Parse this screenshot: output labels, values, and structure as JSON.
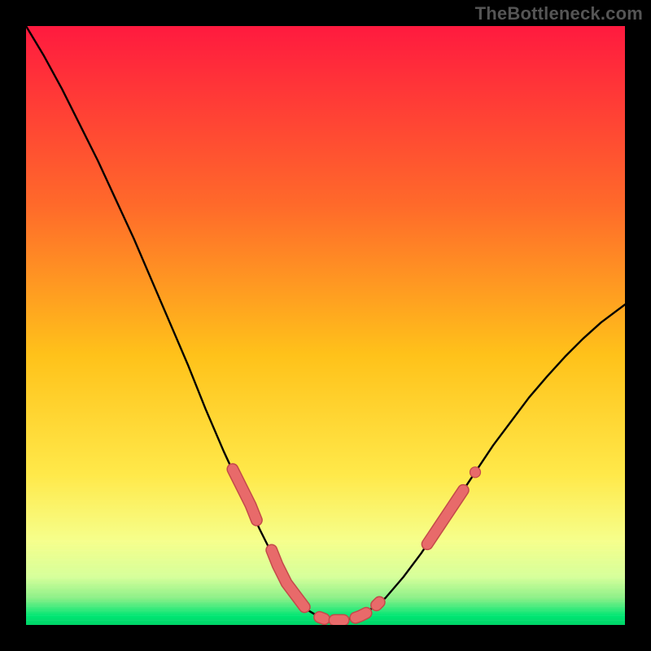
{
  "watermark": "TheBottleneck.com",
  "colors": {
    "page_bg": "#000000",
    "gradient_top": "#ff1a3f",
    "gradient_mid1": "#ff6a2a",
    "gradient_mid2": "#ffc21a",
    "gradient_mid3": "#ffe94a",
    "gradient_bottom_band": "#f6ff8c",
    "gradient_green": "#00e673",
    "curve": "#000000",
    "marker_fill": "#e86a6a",
    "marker_stroke": "#c44a4a"
  },
  "chart_data": {
    "type": "line",
    "title": "",
    "xlabel": "",
    "ylabel": "",
    "xlim": [
      0,
      100
    ],
    "ylim": [
      0,
      100
    ],
    "curve": {
      "x": [
        0,
        3,
        6,
        9,
        12,
        15,
        18,
        21,
        24,
        27,
        30,
        33,
        36,
        39,
        42,
        45,
        47,
        49,
        51,
        53,
        55,
        57,
        60,
        63,
        66,
        69,
        72,
        75,
        78,
        81,
        84,
        87,
        90,
        93,
        96,
        100
      ],
      "y": [
        100,
        95,
        89.5,
        83.5,
        77.5,
        71,
        64.5,
        57.5,
        50.5,
        43.5,
        36,
        29,
        22.5,
        16,
        10,
        5,
        2.5,
        1.3,
        0.8,
        0.8,
        1.2,
        2.2,
        4.5,
        8,
        12,
        16.5,
        21,
        25.5,
        30,
        34,
        38,
        41.5,
        44.8,
        47.8,
        50.5,
        53.5
      ]
    },
    "markers": {
      "groups": [
        {
          "shape": "pill",
          "points": [
            {
              "x": 34.5,
              "y": 26
            },
            {
              "x": 35.5,
              "y": 24
            },
            {
              "x": 36.5,
              "y": 22
            },
            {
              "x": 37.5,
              "y": 20
            },
            {
              "x": 38.5,
              "y": 17.5
            }
          ]
        },
        {
          "shape": "pill",
          "points": [
            {
              "x": 41,
              "y": 12.5
            },
            {
              "x": 42,
              "y": 10
            },
            {
              "x": 43.5,
              "y": 7
            },
            {
              "x": 45,
              "y": 5
            },
            {
              "x": 46.5,
              "y": 3
            }
          ]
        },
        {
          "shape": "pill",
          "points": [
            {
              "x": 49,
              "y": 1.3
            },
            {
              "x": 49.8,
              "y": 1.0
            }
          ]
        },
        {
          "shape": "pill",
          "points": [
            {
              "x": 51.5,
              "y": 0.8
            },
            {
              "x": 53,
              "y": 0.8
            }
          ]
        },
        {
          "shape": "pill",
          "points": [
            {
              "x": 55,
              "y": 1.2
            },
            {
              "x": 55.8,
              "y": 1.5
            },
            {
              "x": 56.8,
              "y": 2.0
            }
          ]
        },
        {
          "shape": "pill",
          "points": [
            {
              "x": 58.5,
              "y": 3.3
            },
            {
              "x": 59,
              "y": 3.8
            }
          ]
        },
        {
          "shape": "pill",
          "points": [
            {
              "x": 67,
              "y": 13.5
            },
            {
              "x": 68,
              "y": 15
            },
            {
              "x": 69,
              "y": 16.5
            },
            {
              "x": 70,
              "y": 18
            },
            {
              "x": 71,
              "y": 19.5
            },
            {
              "x": 72,
              "y": 21
            },
            {
              "x": 73,
              "y": 22.5
            }
          ]
        },
        {
          "shape": "pill",
          "points": [
            {
              "x": 75,
              "y": 25.5
            }
          ]
        }
      ]
    }
  }
}
